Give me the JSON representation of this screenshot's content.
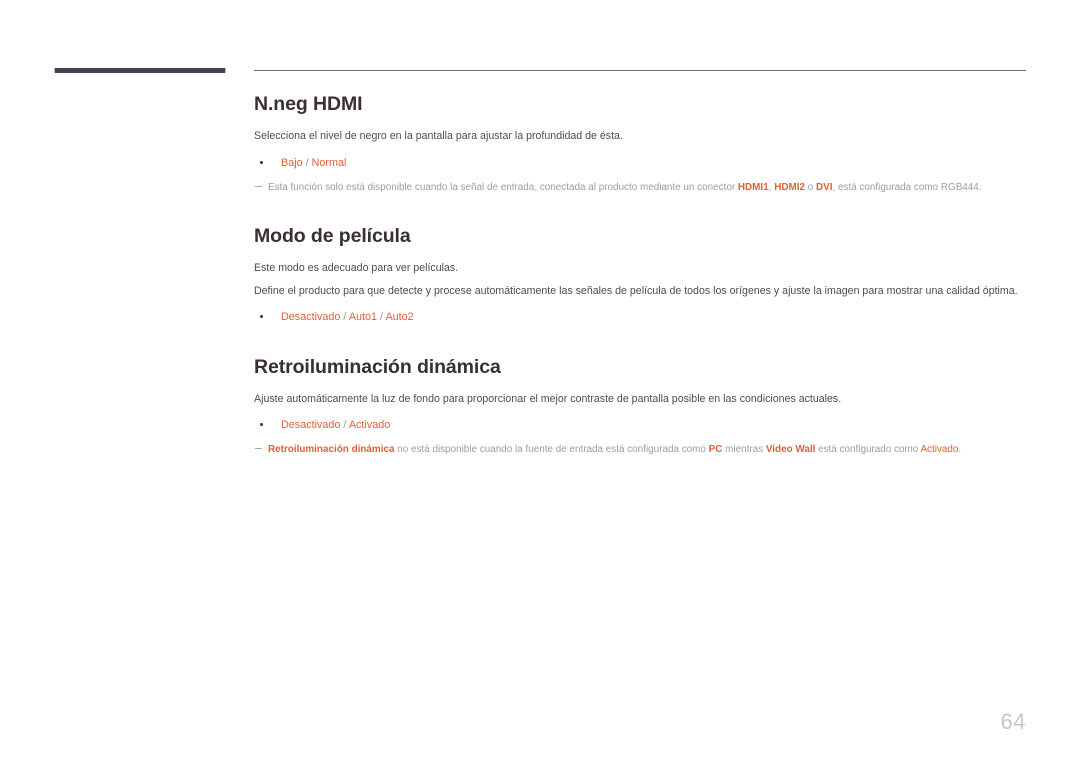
{
  "page": {
    "number": "64",
    "accent_color": "#e0603a",
    "heading_color": "#3a2f36",
    "nav_bar_color": "#454154",
    "note_color": "#9d9d9d"
  },
  "sections": [
    {
      "heading": "N.neg HDMI",
      "paragraphs": [
        "Selecciona el nivel de negro en la pantalla para ajustar la profundidad de ésta."
      ],
      "options": [
        {
          "value": "Bajo",
          "sep": " / "
        },
        {
          "value": "Normal",
          "sep": ""
        }
      ],
      "notes": [
        {
          "segments": [
            {
              "text": "Esta función solo está disponible cuando la señal de entrada, conectada al producto mediante un conector ",
              "style": "plain"
            },
            {
              "text": "HDMI1",
              "style": "highlight"
            },
            {
              "text": ", ",
              "style": "plain"
            },
            {
              "text": "HDMI2",
              "style": "highlight"
            },
            {
              "text": " o ",
              "style": "plain"
            },
            {
              "text": "DVI",
              "style": "highlight"
            },
            {
              "text": ", está configurada como RGB444.",
              "style": "plain"
            }
          ]
        }
      ]
    },
    {
      "heading": "Modo de película",
      "paragraphs": [
        "Este modo es adecuado para ver películas.",
        "Define el producto para que detecte y procese automáticamente las señales de película de todos los orígenes y ajuste la imagen para mostrar una calidad óptima."
      ],
      "options": [
        {
          "value": "Desactivado",
          "sep": " / "
        },
        {
          "value": "Auto1",
          "sep": " / "
        },
        {
          "value": "Auto2",
          "sep": ""
        }
      ],
      "notes": []
    },
    {
      "heading": "Retroiluminación dinámica",
      "paragraphs": [
        "Ajuste automáticamente la luz de fondo para proporcionar el mejor contraste de pantalla posible en las condiciones actuales."
      ],
      "options": [
        {
          "value": "Desactivado",
          "sep": " / "
        },
        {
          "value": "Activado",
          "sep": ""
        }
      ],
      "notes": [
        {
          "segments": [
            {
              "text": "Retroiluminación dinámica",
              "style": "highlight"
            },
            {
              "text": " no está disponible cuando la fuente de entrada está configurada como ",
              "style": "plain"
            },
            {
              "text": "PC",
              "style": "highlight"
            },
            {
              "text": " mientras ",
              "style": "plain"
            },
            {
              "text": "Video Wall",
              "style": "highlight"
            },
            {
              "text": " está configurado como ",
              "style": "plain"
            },
            {
              "text": "Activado",
              "style": "highlight-plain"
            },
            {
              "text": ".",
              "style": "plain"
            }
          ]
        }
      ]
    }
  ]
}
